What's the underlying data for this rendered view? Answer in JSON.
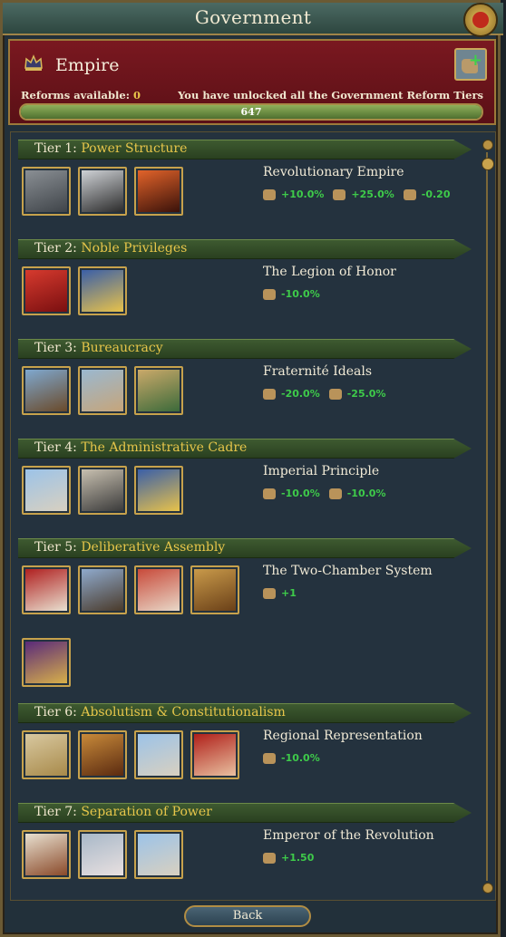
{
  "window": {
    "title": "Government"
  },
  "government": {
    "name": "Empire",
    "reforms_label": "Reforms available:",
    "reforms_value": "0",
    "unlocked_text": "You have unlocked all the Government Reform Tiers",
    "progress_value": "647",
    "progress_fraction": 1.0
  },
  "tiers": [
    {
      "label": "Tier 1:",
      "name": "Power Structure",
      "selected": "Revolutionary Empire",
      "mods": [
        "+10.0%",
        "+25.0%",
        "-0.20"
      ],
      "tiles": [
        "castle",
        "crown",
        "fire"
      ]
    },
    {
      "label": "Tier 2:",
      "name": "Noble Privileges",
      "selected": "The Legion of Honor",
      "mods": [
        "-10.0%"
      ],
      "tiles": [
        "legion-banner",
        "blue-banner"
      ]
    },
    {
      "label": "Tier 3:",
      "name": "Bureaucracy",
      "selected": "Fraternité Ideals",
      "mods": [
        "-20.0%",
        "-25.0%"
      ],
      "tiles": [
        "ship",
        "liberty-statue",
        "wreath"
      ]
    },
    {
      "label": "Tier 4:",
      "name": "The Administrative Cadre",
      "selected": "Imperial Principle",
      "mods": [
        "-10.0%",
        "-10.0%"
      ],
      "tiles": [
        "flag-bearer",
        "clergy",
        "blue-banner"
      ]
    },
    {
      "label": "Tier 5:",
      "name": "Deliberative Assembly",
      "selected": "The Two-Chamber System",
      "mods": [
        "+1"
      ],
      "tiles": [
        "judge",
        "rider",
        "revolution",
        "hall",
        "king"
      ]
    },
    {
      "label": "Tier 6:",
      "name": "Absolutism & Constitutionalism",
      "selected": "Regional Representation",
      "mods": [
        "-10.0%"
      ],
      "tiles": [
        "monarch",
        "parliament",
        "flag-bearer",
        "cardinal"
      ]
    },
    {
      "label": "Tier 7:",
      "name": "Separation of Power",
      "selected": "Emperor of the Revolution",
      "mods": [
        "+1.50"
      ],
      "tiles": [
        "napoleon",
        "king-portrait",
        "flag-bearer"
      ]
    }
  ],
  "footer": {
    "back_label": "Back"
  },
  "colors": {
    "mod_positive": "#3ecb4a",
    "tier_name": "#e7c64a",
    "frame_gold": "#c7a24c"
  }
}
